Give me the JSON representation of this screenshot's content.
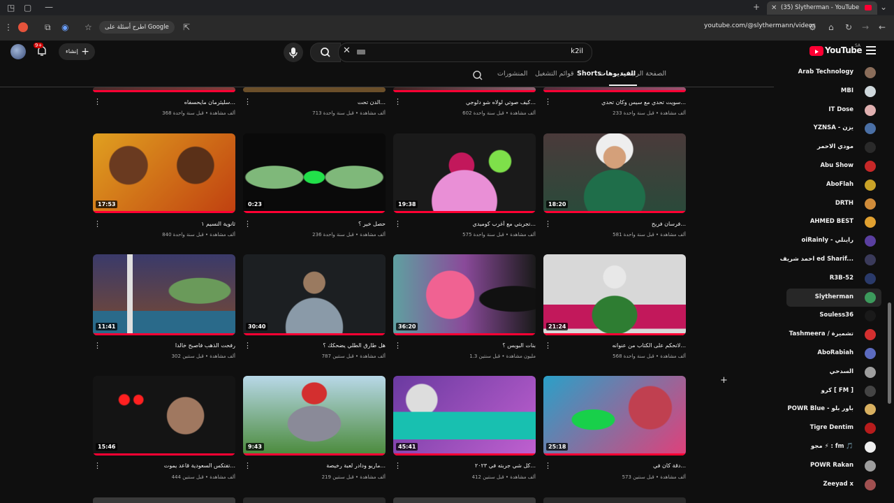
{
  "browser": {
    "tab_title": "(35) Slytherman - YouTube",
    "url": "youtube.com/@slythermann/videos",
    "google_pill": "اطرح أسئلة على Google"
  },
  "header": {
    "logo_text": "YouTube",
    "logo_region": "SA",
    "search_value": "k2il",
    "create_label": "إنشاء",
    "notif_badge": "9+"
  },
  "channel_tabs": [
    {
      "label": "الصفحة الرئيسية"
    },
    {
      "label": "الفيديوهات"
    },
    {
      "label": "Shorts"
    },
    {
      "label": "قوائم التشغيل"
    },
    {
      "label": "المنشورات"
    }
  ],
  "row0": [
    {
      "title": "سويت تحدي مع سيس وكان تحدي...",
      "meta": "233 ألف مشاهدة • قبل سنة واحدة"
    },
    {
      "title": "كيف صوتي لولاه شو دلوجي...",
      "meta": "602 ألف مشاهدة • قبل سنة واحدة"
    },
    {
      "title": "الدن تحت...",
      "meta": "713 ألف مشاهدة • قبل سنة واحدة"
    },
    {
      "title": "سليثرمان مايحسفاه...",
      "meta": "368 ألف مشاهدة • قبل سنة واحدة"
    }
  ],
  "row1": [
    {
      "title": "فرسان فريح...",
      "meta": "581 ألف مشاهدة • قبل سنة واحدة",
      "duration": "18:20"
    },
    {
      "title": "تجربتي مع أغرب كوميدي...",
      "meta": "575 ألف مشاهدة • قبل سنة واحدة",
      "duration": "19:38"
    },
    {
      "title": "حصل خير ؟",
      "meta": "236 ألف مشاهدة • قبل سنة واحدة",
      "duration": "0:23"
    },
    {
      "title": "ثانوية النسيم ١",
      "meta": "840 ألف مشاهدة • قبل سنة واحدة",
      "duration": "17:53"
    }
  ],
  "row2": [
    {
      "title": "لاتحكم على الكتاب من عنوانه...",
      "meta": "568 ألف مشاهدة • قبل سنة واحدة",
      "duration": "21:24"
    },
    {
      "title": "بنات البوبس ؟",
      "meta": "1.3 مليون مشاهدة • قبل سنتين",
      "duration": "36:20"
    },
    {
      "title": "هل طارق الطلي يضحكك ؟",
      "meta": "787 ألف مشاهدة • قبل سنتين",
      "duration": "30:40"
    },
    {
      "title": "رفحت الذهب فاصبح خالدا",
      "meta": "302 ألف مشاهدة • قبل سنتين",
      "duration": "11:41"
    }
  ],
  "row3": [
    {
      "title": "دقة كان في...",
      "meta": "573 ألف مشاهدة • قبل سنتين",
      "duration": "25:18"
    },
    {
      "title": "كل شي جربته في ٢٠٢٣...",
      "meta": "412 ألف مشاهدة • قبل سنتين",
      "duration": "45:41"
    },
    {
      "title": "ماريو ودادر لعبة رخيصة...",
      "meta": "219 ألف مشاهدة • قبل سنتين",
      "duration": "9:43"
    },
    {
      "title": "تفتكس السعودية قاعد يموت...",
      "meta": "444 ألف مشاهدة • قبل سنتين",
      "duration": "15:46"
    }
  ],
  "sidebar": [
    {
      "label": "Arab Technology",
      "color": "#8a6d5a"
    },
    {
      "label": "MBI",
      "color": "#cfd8dc"
    },
    {
      "label": "IT Dose",
      "color": "#e0b0b0"
    },
    {
      "label": "YZNSA - يزن",
      "color": "#4a6fa5"
    },
    {
      "label": "مودي الاحمر",
      "color": "#2a2a2a"
    },
    {
      "label": "Abu Show",
      "color": "#c62828"
    },
    {
      "label": "AboFlah",
      "color": "#c9a227"
    },
    {
      "label": "DRTH",
      "color": "#d08c3a"
    },
    {
      "label": "AHMED BEST",
      "color": "#e0a030"
    },
    {
      "label": "oiRainly - راينلي",
      "color": "#5a3fa0"
    },
    {
      "label": "احمد شريف ed Sharif...",
      "color": "#3a3a5a"
    },
    {
      "label": "R3B-52",
      "color": "#2a3a6a"
    },
    {
      "label": "Slytherman",
      "color": "#3c9a5c"
    },
    {
      "label": "Souless36",
      "color": "#1a1a1a"
    },
    {
      "label": "Tashmeera / تشميرة",
      "color": "#d32f2f"
    },
    {
      "label": "AboRabiah",
      "color": "#5c6bc0"
    },
    {
      "label": "السدحي",
      "color": "#9e9e9e"
    },
    {
      "label": "كرو [ FM ]",
      "color": "#444"
    },
    {
      "label": "POWR Blue - باور بلو",
      "color": "#d8b060"
    },
    {
      "label": "Tigre Dentim",
      "color": "#b71c1c"
    },
    {
      "label": "مجو ⚡ : fm 🎵",
      "color": "#eeeeee"
    },
    {
      "label": "POWR Rakan",
      "color": "#9e9e9e"
    },
    {
      "label": "Zeeyad x",
      "color": "#a05050"
    }
  ],
  "colors": {
    "accent": "#ff0033",
    "bg": "#0f0f0f",
    "sidebar_active": "#272727"
  }
}
